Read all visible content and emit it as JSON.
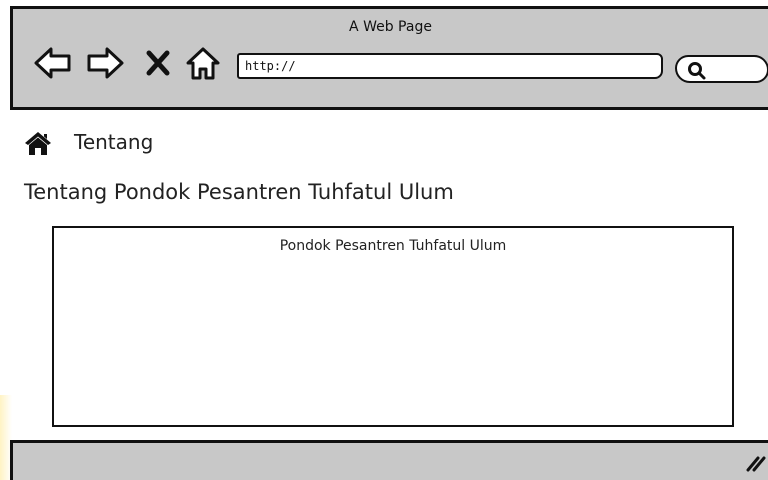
{
  "window": {
    "title": "A Web Page"
  },
  "toolbar": {
    "icons": [
      "back-icon",
      "forward-icon",
      "close-icon",
      "home-icon"
    ],
    "url": "http://",
    "search_icon": "search-icon"
  },
  "breadcrumb": {
    "icon": "home-icon",
    "label": "Tentang"
  },
  "main": {
    "title": "Tentang Pondok Pesantren Tuhfatul Ulum",
    "box_title": "Pondok Pesantren Tuhfatul Ulum"
  },
  "colors": {
    "chrome": "#c8c8c8",
    "border": "#111111",
    "background": "#ffffff"
  }
}
